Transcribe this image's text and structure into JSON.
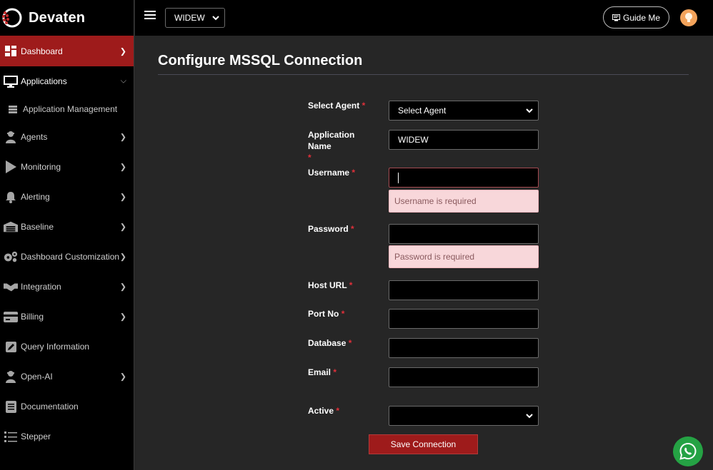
{
  "brand": {
    "name": "Devaten",
    "accent": "#9e1b1b"
  },
  "sidebar": {
    "items": [
      {
        "label": "Dashboard",
        "icon": "dashboard-icon"
      },
      {
        "label": "Applications",
        "icon": "monitor-icon"
      },
      {
        "label": "Application Management",
        "icon": "server-icon"
      },
      {
        "label": "Agents",
        "icon": "agent-icon"
      },
      {
        "label": "Monitoring",
        "icon": "play-icon"
      },
      {
        "label": "Alerting",
        "icon": "bell-icon"
      },
      {
        "label": "Baseline",
        "icon": "warehouse-icon"
      },
      {
        "label": "Dashboard Customization",
        "icon": "gears-icon"
      },
      {
        "label": "Integration",
        "icon": "handshake-icon"
      },
      {
        "label": "Billing",
        "icon": "billing-icon"
      },
      {
        "label": "Query Information",
        "icon": "edit-icon"
      },
      {
        "label": "Open-AI",
        "icon": "agent-icon"
      },
      {
        "label": "Documentation",
        "icon": "document-icon"
      },
      {
        "label": "Stepper",
        "icon": "list-icon"
      }
    ]
  },
  "topbar": {
    "app_selected": "WIDEW",
    "guide_label": "Guide Me"
  },
  "page": {
    "title": "Configure MSSQL Connection"
  },
  "form": {
    "select_agent": {
      "label": "Select Agent",
      "value": "Select Agent"
    },
    "app_name": {
      "label": "Application Name",
      "value": "WIDEW"
    },
    "username": {
      "label": "Username",
      "value": "",
      "error": "Username is required"
    },
    "password": {
      "label": "Password",
      "value": "",
      "error": "Password is required"
    },
    "host_url": {
      "label": "Host URL",
      "value": ""
    },
    "port_no": {
      "label": "Port No",
      "value": ""
    },
    "database": {
      "label": "Database",
      "value": ""
    },
    "email": {
      "label": "Email",
      "value": ""
    },
    "active": {
      "label": "Active",
      "value": ""
    },
    "required_mark": "*",
    "save_label": "Save Connection"
  }
}
